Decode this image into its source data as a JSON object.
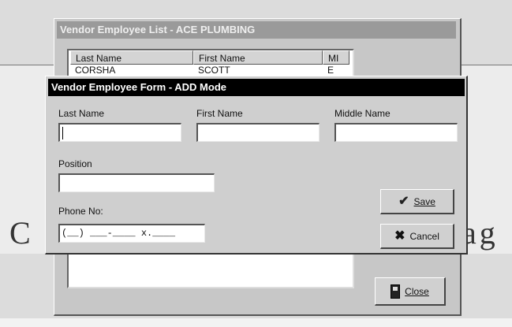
{
  "background": {
    "text_left": "C",
    "text_right": "ag"
  },
  "list_window": {
    "title": "Vendor Employee List - ACE PLUMBING",
    "columns": [
      "Last Name",
      "First Name",
      "MI"
    ],
    "rows": [
      {
        "last": "CORSHA",
        "first": "SCOTT",
        "mi": "E"
      }
    ],
    "close_label": "Close"
  },
  "form": {
    "title": "Vendor Employee Form - ADD Mode",
    "last_name": {
      "label": "Last Name",
      "value": ""
    },
    "first_name": {
      "label": "First Name",
      "value": ""
    },
    "middle_name": {
      "label": "Middle Name",
      "value": ""
    },
    "position": {
      "label": "Position",
      "value": ""
    },
    "phone": {
      "label": "Phone No:",
      "value": "(__) ___-____ x.____"
    },
    "save_label": "Save",
    "cancel_label": "Cancel"
  },
  "icons": {
    "save": "check-icon",
    "cancel": "x-icon",
    "close": "door-icon"
  }
}
